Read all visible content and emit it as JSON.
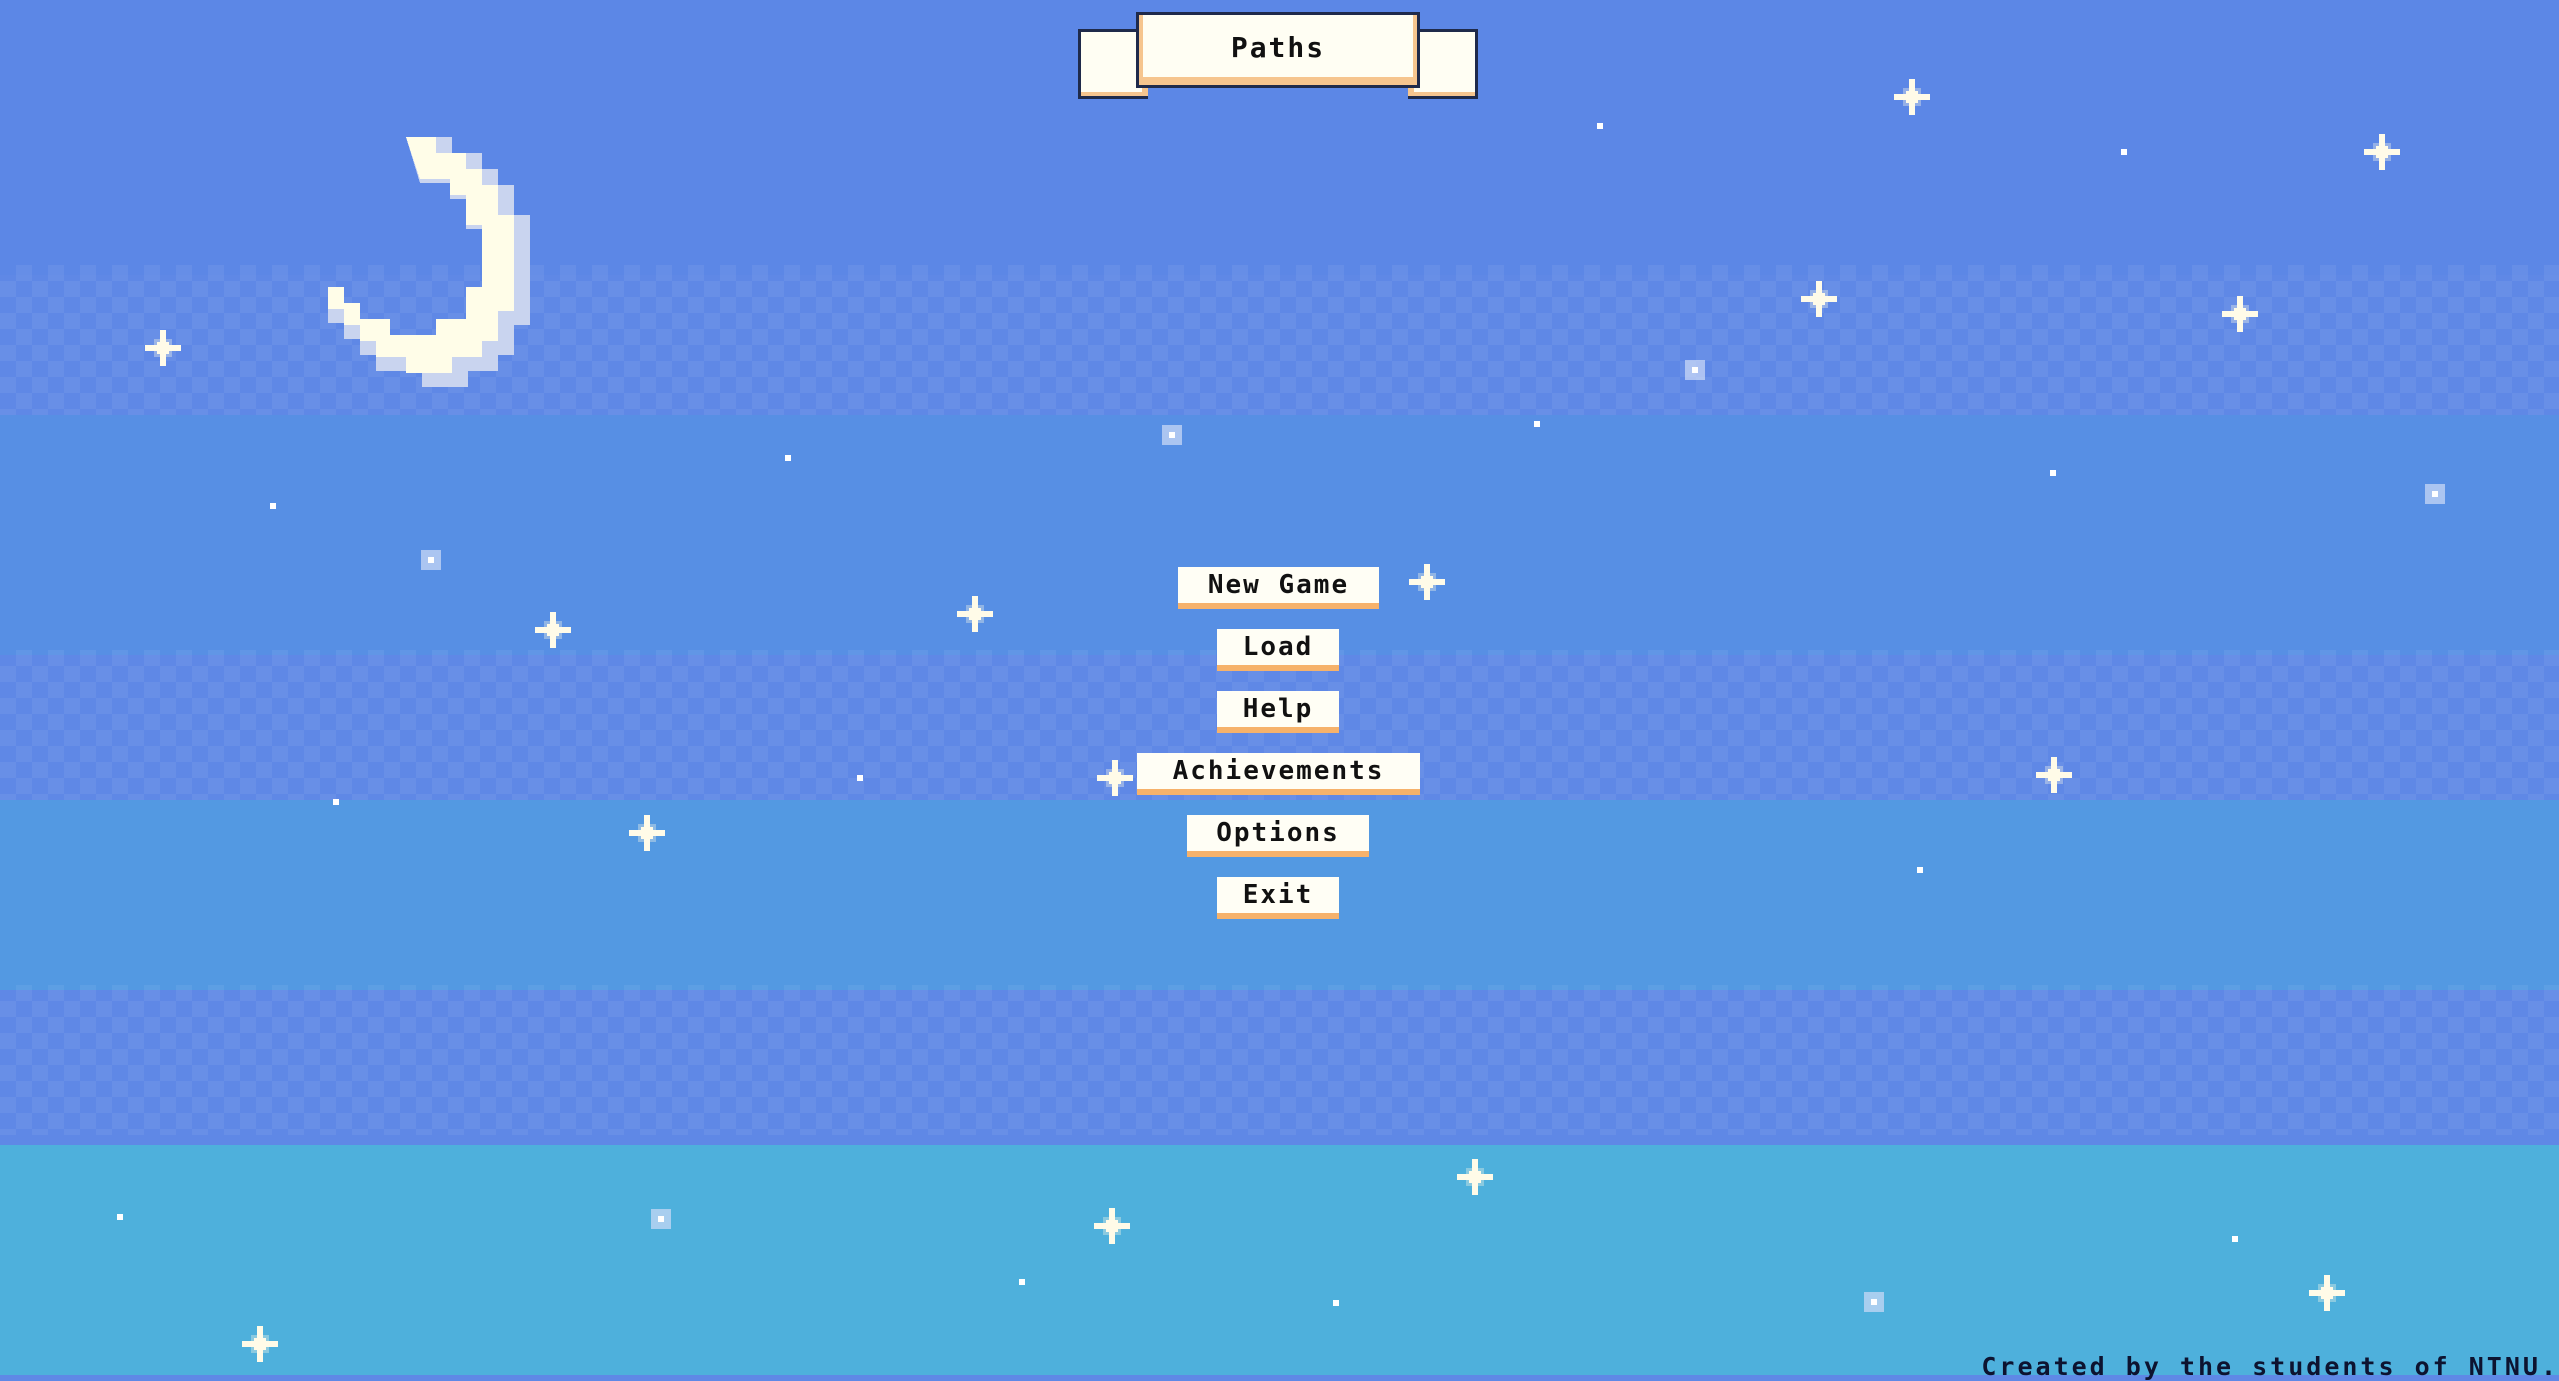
{
  "game": {
    "title": "Paths",
    "credits": "Created by the students of NTNU."
  },
  "menu": {
    "items": [
      {
        "id": "new-game",
        "label": "New Game"
      },
      {
        "id": "load",
        "label": "Load"
      },
      {
        "id": "help",
        "label": "Help"
      },
      {
        "id": "achievements",
        "label": "Achievements"
      },
      {
        "id": "options",
        "label": "Options"
      },
      {
        "id": "exit",
        "label": "Exit"
      }
    ]
  },
  "theme": {
    "sky_top": "#5c86e6",
    "sky_mid": "#5498e2",
    "sky_bottom": "#4fb0dc",
    "moon": "#fffde8",
    "button_bg": "#fffef5",
    "button_shadow": "#f6b26b",
    "text": "#111111"
  },
  "icons": {
    "moon": "crescent-moon-icon",
    "star": "sparkle-star-icon"
  }
}
